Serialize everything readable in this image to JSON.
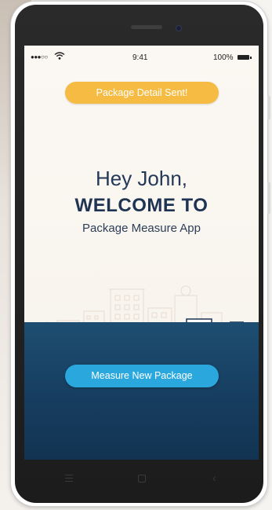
{
  "status_bar": {
    "signal": "●●●○○",
    "time": "9:41",
    "battery": "100%"
  },
  "toast": {
    "label": "Package Detail Sent!"
  },
  "hero": {
    "greeting": "Hey John,",
    "welcome": "WELCOME TO",
    "app_name": "Package Measure App"
  },
  "actions": {
    "measure_label": "Measure New Package"
  },
  "colors": {
    "accent_yellow": "#f6bb42",
    "accent_blue": "#2aa8de",
    "navy": "#1f3352",
    "panel": "#1d4e72",
    "truck_red": "#e04545"
  },
  "icons": [
    "wifi-icon",
    "battery-icon",
    "delivery-truck-icon",
    "package-box-icon",
    "menu-icon",
    "home-icon",
    "back-icon"
  ]
}
